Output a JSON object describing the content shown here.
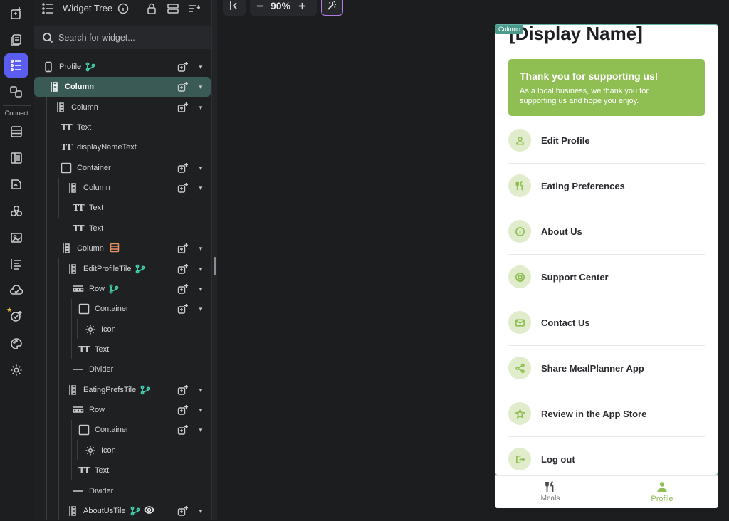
{
  "rail": {
    "connect_label": "Connect"
  },
  "tree_panel": {
    "title": "Widget Tree",
    "search_placeholder": "Search for widget...",
    "nodes": [
      {
        "label": "Profile"
      },
      {
        "label": "Column"
      },
      {
        "label": "Column"
      },
      {
        "label": "Text"
      },
      {
        "label": "displayNameText"
      },
      {
        "label": "Container"
      },
      {
        "label": "Column"
      },
      {
        "label": "Text"
      },
      {
        "label": "Text"
      },
      {
        "label": "Column"
      },
      {
        "label": "EditProfileTile"
      },
      {
        "label": "Row"
      },
      {
        "label": "Container"
      },
      {
        "label": "Icon"
      },
      {
        "label": "Text"
      },
      {
        "label": "Divider"
      },
      {
        "label": "EatingPrefsTile"
      },
      {
        "label": "Row"
      },
      {
        "label": "Container"
      },
      {
        "label": "Icon"
      },
      {
        "label": "Text"
      },
      {
        "label": "Divider"
      },
      {
        "label": "AboutUsTile"
      }
    ]
  },
  "toolbar": {
    "zoom": "90%"
  },
  "preview": {
    "selection_tag": "Column",
    "display_name": "[Display Name]",
    "card": {
      "title": "Thank you for supporting us!",
      "body": "As a local business, we thank you for supporting us and hope you enjoy."
    },
    "tiles": [
      {
        "label": "Edit Profile",
        "icon": "person-icon"
      },
      {
        "label": "Eating Preferences",
        "icon": "utensils-icon"
      },
      {
        "label": "About Us",
        "icon": "info-icon"
      },
      {
        "label": "Support Center",
        "icon": "lifebuoy-icon"
      },
      {
        "label": "Contact Us",
        "icon": "mail-icon"
      },
      {
        "label": "Share MealPlanner App",
        "icon": "share-icon"
      },
      {
        "label": "Review in the App Store",
        "icon": "star-icon"
      },
      {
        "label": "Log out",
        "icon": "logout-icon"
      }
    ],
    "nav": {
      "meals": "Meals",
      "profile": "Profile"
    },
    "colors": {
      "accent": "#8fbf53",
      "tile_circle": "#e1eccd",
      "selection": "#4b9b8d",
      "rail_active": "#5b5cf0"
    }
  }
}
